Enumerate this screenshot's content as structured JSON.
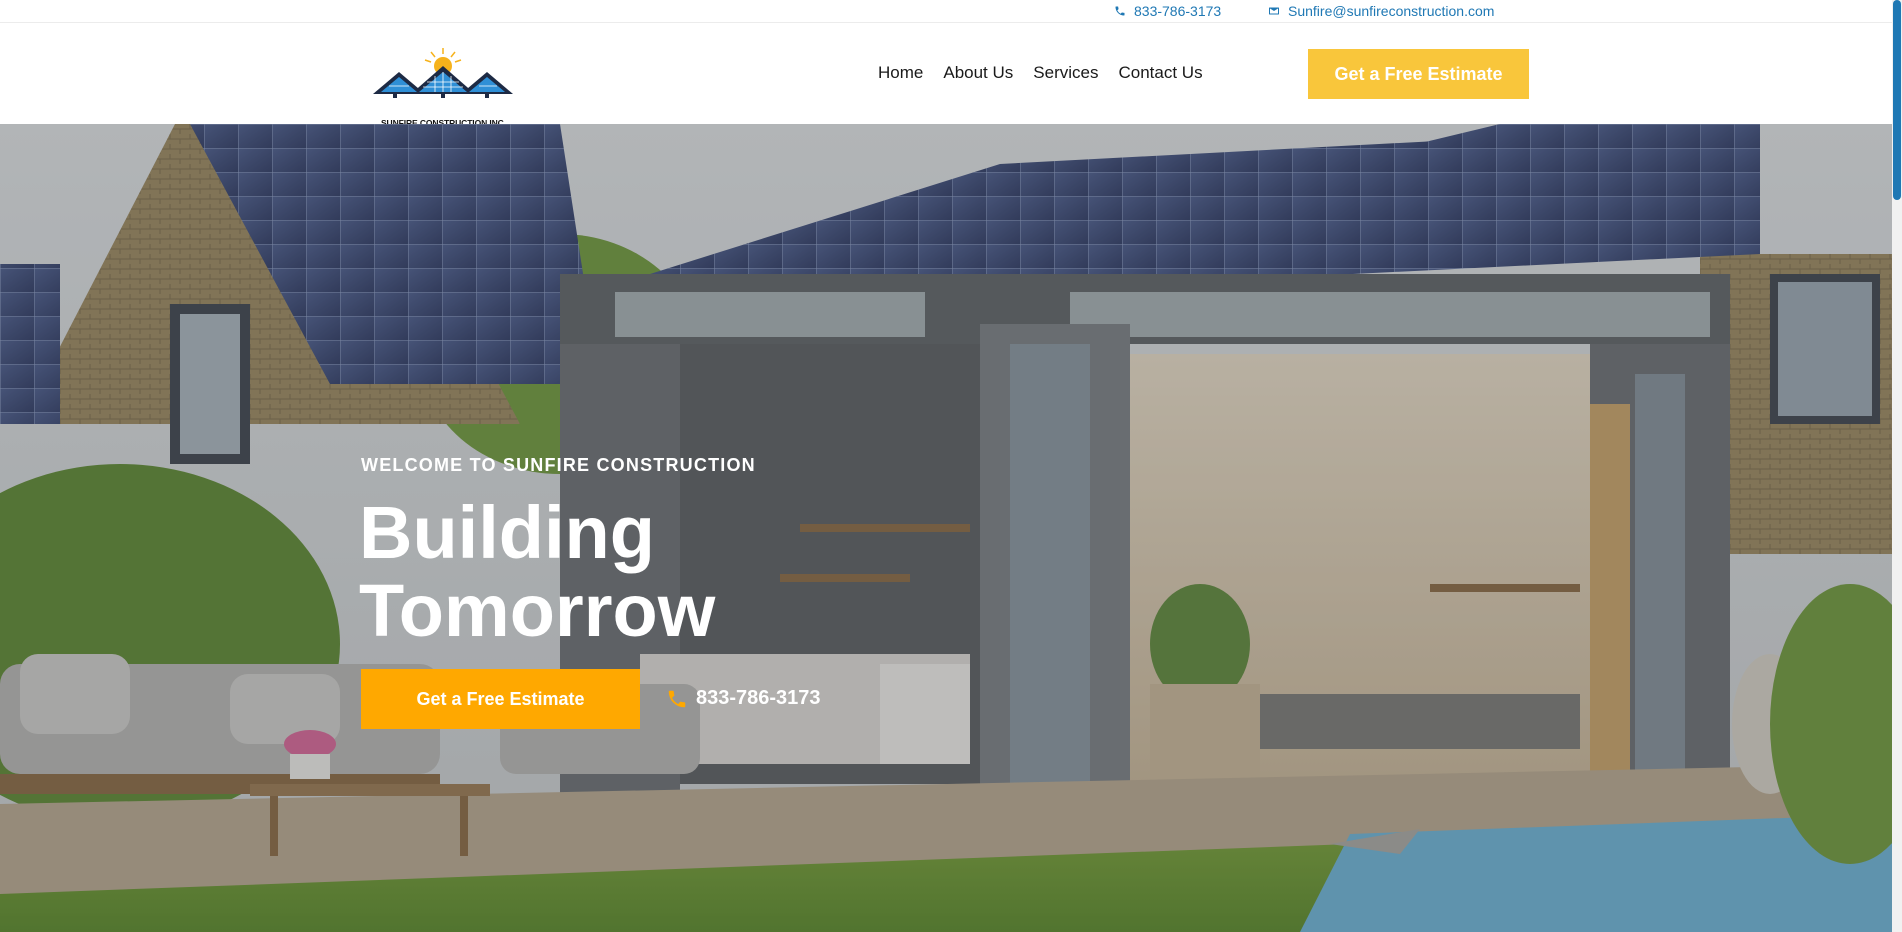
{
  "topbar": {
    "phone": "833-786-3173",
    "email": "Sunfire@sunfireconstruction.com",
    "phone_icon": "phone-icon",
    "email_icon": "envelope-icon",
    "accent_color": "#1f78b4"
  },
  "header": {
    "logo_text": "SUNFIRE CONSTRUCTION INC.",
    "nav": [
      "Home",
      "About Us",
      "Services",
      "Contact Us"
    ],
    "cta_label": "Get a Free Estimate",
    "cta_color": "#f9c63b"
  },
  "hero": {
    "eyebrow": "WELCOME TO SUNFIRE CONSTRUCTION",
    "title_line1": "Building",
    "title_line2": "Tomorrow",
    "cta_label": "Get a Free Estimate",
    "cta_color": "#ffa800",
    "phone": "833-786-3173",
    "phone_icon": "phone-icon"
  }
}
